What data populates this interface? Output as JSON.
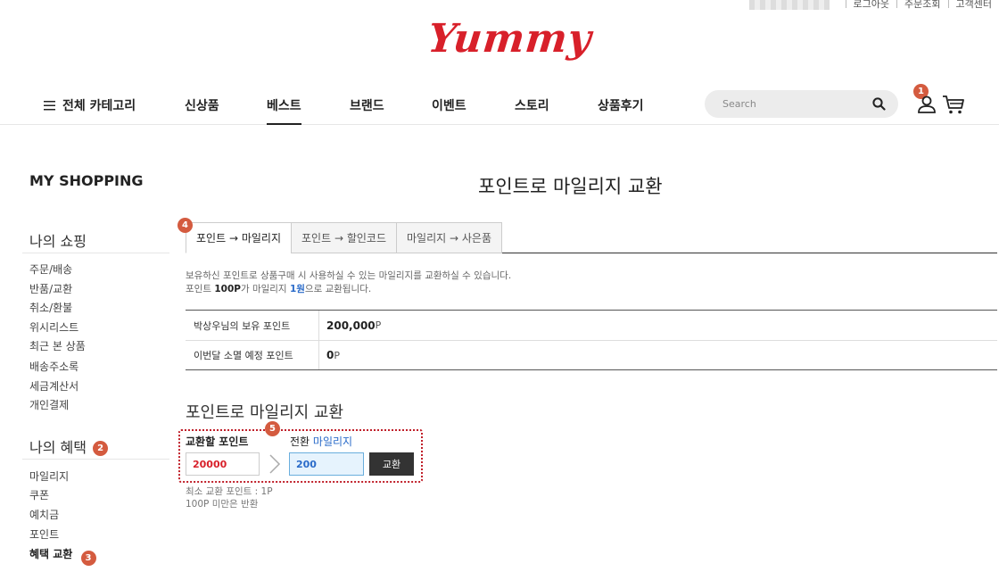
{
  "util": {
    "links": [
      "로그아웃",
      "주문조회",
      "고객센터"
    ]
  },
  "brand": {
    "logo": "Yummy",
    "color": "#d8202a"
  },
  "nav": {
    "all_category": "전체 카테고리",
    "items": [
      "신상품",
      "베스트",
      "브랜드",
      "이벤트",
      "스토리",
      "상품후기"
    ],
    "active": "베스트",
    "search_placeholder": "Search",
    "cart_badge": "1"
  },
  "sidebar": {
    "title": "MY SHOPPING",
    "shopping_group": "나의 쇼핑",
    "shopping_items": [
      "주문/배송",
      "반품/교환",
      "취소/환불",
      "위시리스트",
      "최근 본 상품",
      "배송주소록",
      "세금계산서",
      "개인결제"
    ],
    "benefit_group": "나의 혜택",
    "benefit_badge": "2",
    "benefit_items": [
      "마일리지",
      "쿠폰",
      "예치금",
      "포인트",
      "혜택 교환"
    ],
    "active_item": "혜택 교환",
    "active_badge": "3"
  },
  "main": {
    "title": "포인트로 마일리지 교환",
    "tab_badge": "4",
    "tabs": [
      "포인트 → 마일리지",
      "포인트 → 할인코드",
      "마일리지 → 사은품"
    ],
    "desc_line1": "보유하신 포인트로 상품구매 시 사용하실 수 있는 마일리지를 교환하실 수 있습니다.",
    "desc_line2_a": "포인트 ",
    "desc_line2_b": "100P",
    "desc_line2_c": "가 마일리지 ",
    "desc_line2_d": "1원",
    "desc_line2_e": "으로 교환됩니다.",
    "table": [
      {
        "label": "박상우님의 보유 포인트",
        "value": "200,000",
        "unit": "P"
      },
      {
        "label": "이번달 소멸 예정 포인트",
        "value": "0",
        "unit": "P"
      }
    ],
    "exchange_title": "포인트로 마일리지 교환",
    "exchange_badge": "5",
    "from_label": "교환할 포인트",
    "to_label_a": "전환 ",
    "to_label_b": "마일리지",
    "from_value": "20000",
    "to_value": "200",
    "button": "교환",
    "note1": "최소 교환 포인트 : 1P",
    "note2": "100P 미만은 반환"
  },
  "colors": {
    "badge": "#d45b3f",
    "accent_blue": "#2a6bc9",
    "red_value": "#d8202a"
  }
}
